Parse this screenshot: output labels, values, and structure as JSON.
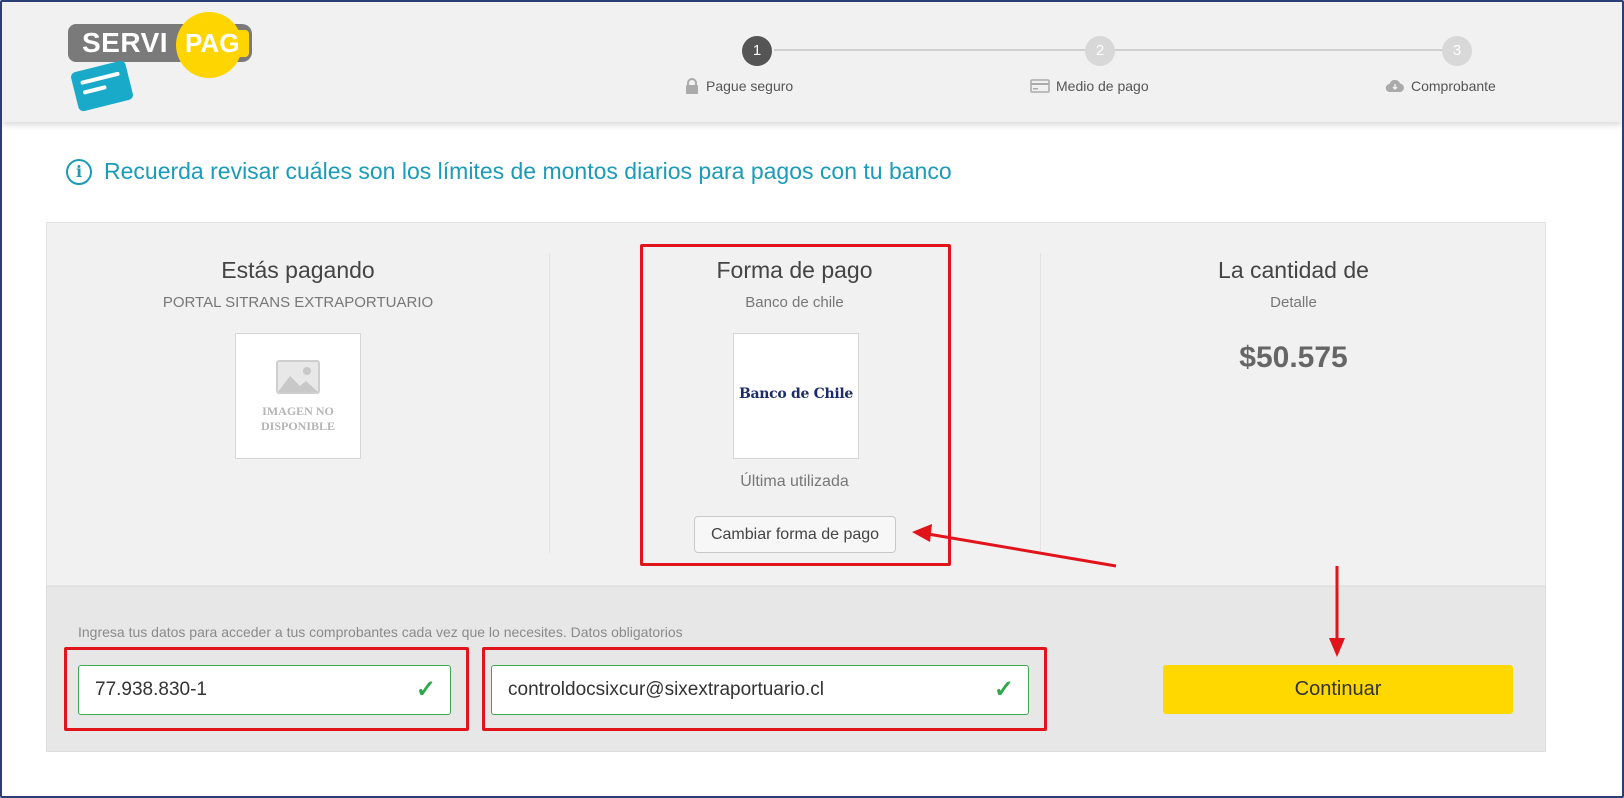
{
  "header": {
    "logo_text_left": "SERVI",
    "logo_text_right": "PAG",
    "steps": [
      {
        "number": "1",
        "label": "Pague seguro",
        "icon": "lock-icon",
        "active": true
      },
      {
        "number": "2",
        "label": "Medio de pago",
        "icon": "card-icon",
        "active": false
      },
      {
        "number": "3",
        "label": "Comprobante",
        "icon": "cloud-icon",
        "active": false
      }
    ]
  },
  "notice": {
    "icon": "info-icon",
    "text": "Recuerda revisar cuáles son los límites de montos diarios para pagos con tu banco"
  },
  "summary": {
    "paying": {
      "title": "Estás pagando",
      "subtitle": "PORTAL SITRANS EXTRAPORTUARIO",
      "image_text_1": "IMAGEN NO",
      "image_text_2": "DISPONIBLE"
    },
    "payment_method": {
      "title": "Forma de pago",
      "subtitle": "Banco de chile",
      "logo_text": "Banco de Chile",
      "last_used": "Última utilizada",
      "change_button": "Cambiar forma de pago"
    },
    "amount": {
      "title": "La cantidad de",
      "subtitle": "Detalle",
      "value": "$50.575"
    }
  },
  "form": {
    "hint": "Ingresa tus datos para acceder a tus comprobantes cada vez que lo necesites. Datos obligatorios",
    "rut_value": "77.938.830-1",
    "email_value": "controldocsixcur@sixextraportuario.cl",
    "continue_button": "Continuar"
  },
  "colors": {
    "accent": "#1a9bb8",
    "brand_yellow": "#ffd800",
    "valid_green": "#2ea84a",
    "annotation_red": "#e1141c"
  }
}
